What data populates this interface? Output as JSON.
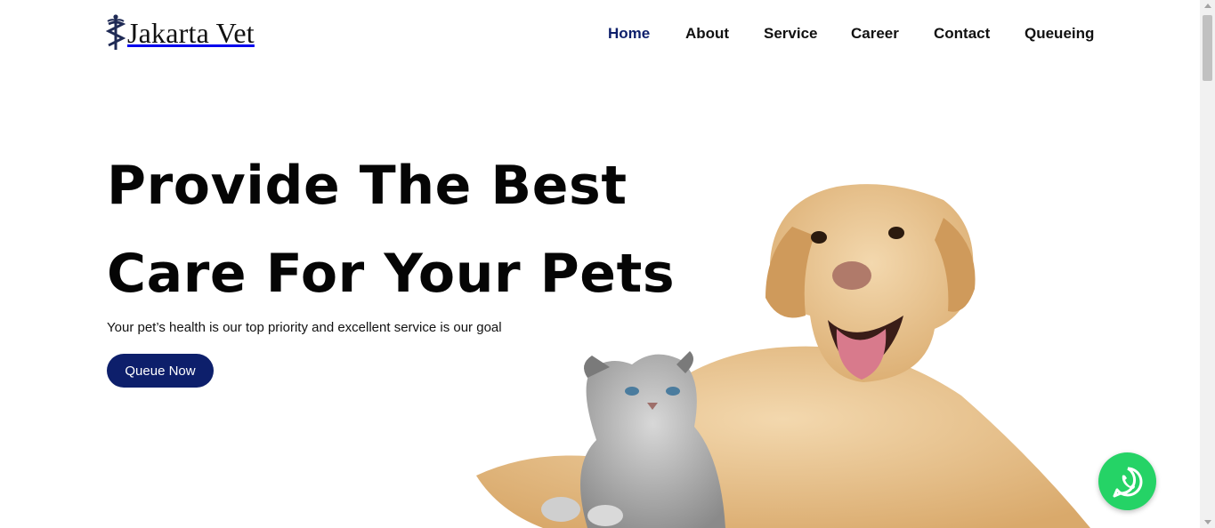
{
  "brand": {
    "name": "Jakarta Vet",
    "logo_icon": "caduceus-icon"
  },
  "nav": {
    "items": [
      {
        "label": "Home",
        "active": true
      },
      {
        "label": "About",
        "active": false
      },
      {
        "label": "Service",
        "active": false
      },
      {
        "label": "Career",
        "active": false
      },
      {
        "label": "Contact",
        "active": false
      },
      {
        "label": "Queueing",
        "active": false
      }
    ]
  },
  "hero": {
    "title_line1": "Provide The Best",
    "title_line2": "Care For Your Pets",
    "subtitle": "Your pet’s health is our top priority and excellent service is our goal",
    "cta_label": "Queue Now",
    "image": "dog-and-kitten-photo"
  },
  "floating": {
    "icon": "whatsapp-icon"
  },
  "colors": {
    "primary": "#0d1f6b",
    "whatsapp": "#25d366",
    "text": "#111111"
  }
}
